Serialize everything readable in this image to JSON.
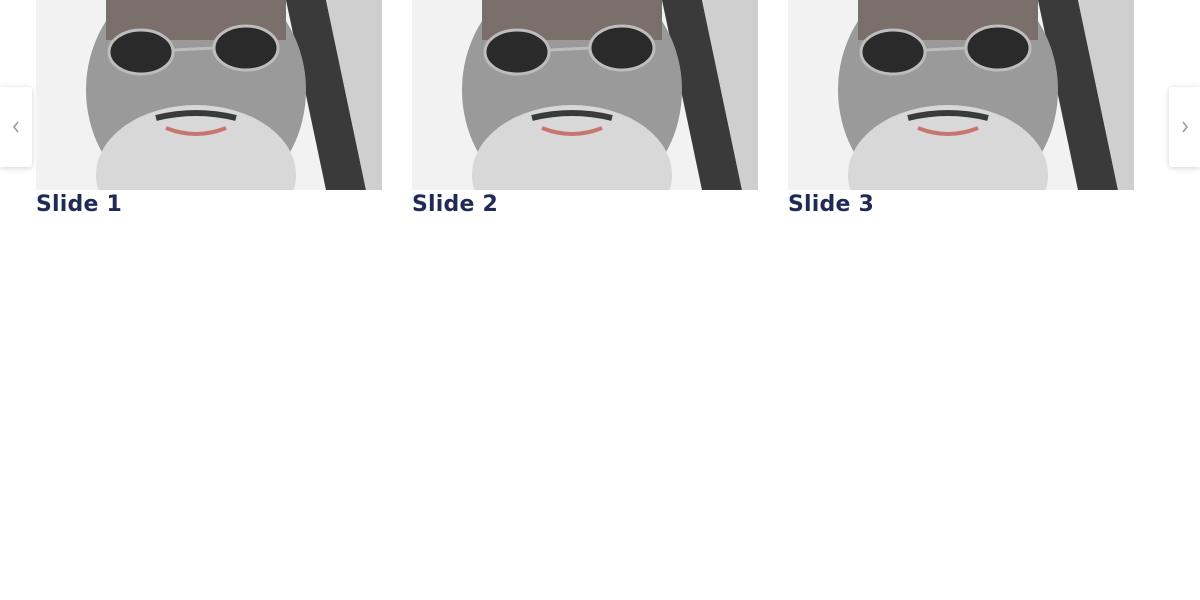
{
  "carousel": {
    "slides": [
      {
        "title": "Slide 1",
        "image": "portrait-photo"
      },
      {
        "title": "Slide 2",
        "image": "portrait-photo"
      },
      {
        "title": "Slide 3",
        "image": "portrait-photo"
      }
    ],
    "controls": {
      "prev_icon": "chevron-left-icon",
      "next_icon": "chevron-right-icon"
    }
  },
  "colors": {
    "title": "#1f2a56",
    "background": "#ffffff"
  }
}
